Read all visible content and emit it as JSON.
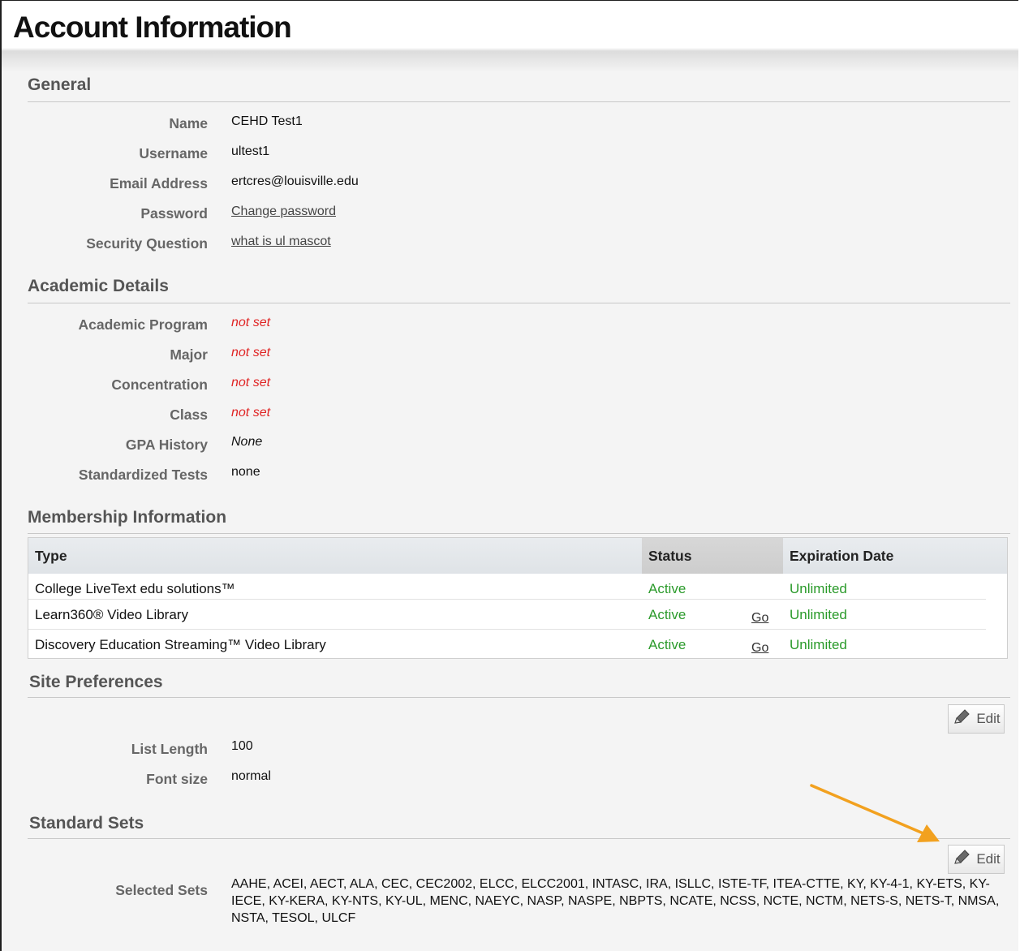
{
  "page": {
    "title": "Account Information"
  },
  "general": {
    "title": "General",
    "name_label": "Name",
    "name_value": "CEHD Test1",
    "username_label": "Username",
    "username_value": "ultest1",
    "email_label": "Email Address",
    "email_value": "ertcres@louisville.edu",
    "password_label": "Password",
    "password_value": "Change password",
    "security_label": "Security Question",
    "security_value": "what is ul mascot"
  },
  "academic": {
    "title": "Academic Details",
    "program_label": "Academic Program",
    "program_value": "not set",
    "major_label": "Major",
    "major_value": "not set",
    "concentration_label": "Concentration",
    "concentration_value": "not set",
    "class_label": "Class",
    "class_value": "not set",
    "gpa_label": "GPA History",
    "gpa_value": "None",
    "tests_label": "Standardized Tests",
    "tests_value": "none"
  },
  "membership": {
    "title": "Membership Information",
    "headers": {
      "type": "Type",
      "status": "Status",
      "expiration": "Expiration Date"
    },
    "rows": [
      {
        "type": "College LiveText edu solutions™",
        "status": "Active",
        "go": "",
        "expiration": "Unlimited"
      },
      {
        "type": "Learn360® Video Library",
        "status": "Active",
        "go": "Go",
        "expiration": "Unlimited"
      },
      {
        "type": "Discovery Education Streaming™ Video Library",
        "status": "Active",
        "go": "Go",
        "expiration": "Unlimited"
      }
    ]
  },
  "site_prefs": {
    "title": "Site Preferences",
    "edit_label": "Edit",
    "list_length_label": "List Length",
    "list_length_value": "100",
    "font_size_label": "Font size",
    "font_size_value": "normal"
  },
  "standard_sets": {
    "title": "Standard Sets",
    "edit_label": "Edit",
    "selected_label": "Selected Sets",
    "selected_value": "AAHE, ACEI, AECT, ALA, CEC, CEC2002, ELCC, ELCC2001, INTASC, IRA, ISLLC, ISTE-TF, ITEA-CTTE, KY, KY-4-1, KY-ETS, KY-IECE, KY-KERA, KY-NTS, KY-UL, MENC, NAEYC, NASP, NASPE, NBPTS, NCATE, NCSS, NCTE, NCTM, NETS-S, NETS-T, NMSA, NSTA, TESOL, ULCF"
  },
  "colors": {
    "not_set": "#e02424",
    "active": "#2a9a2a",
    "arrow": "#f2a11f"
  },
  "icons": {
    "edit": "pencil-icon",
    "annotation": "arrow-annotation"
  }
}
